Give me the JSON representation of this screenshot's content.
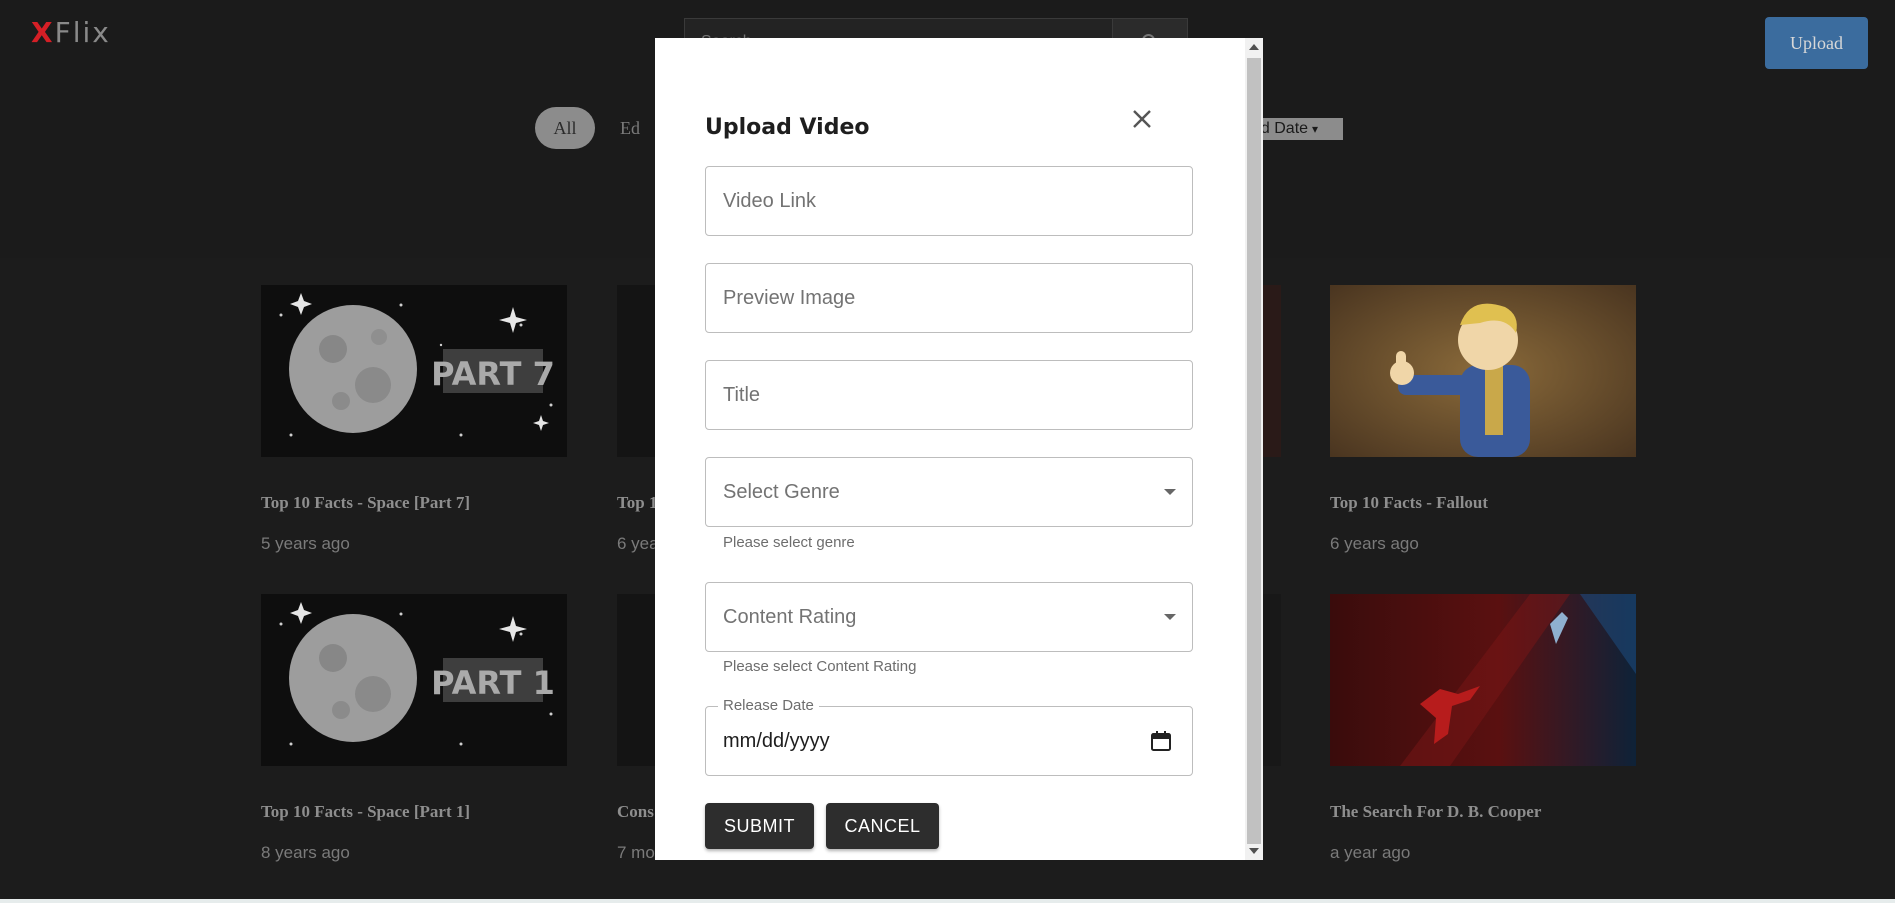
{
  "header": {
    "logo_x": "X",
    "logo_rest": "Flix",
    "search_placeholder": "Search",
    "upload_label": "Upload"
  },
  "filters": {
    "genres": [
      "All",
      "Ed"
    ],
    "sort_label": "ad Date"
  },
  "videos": [
    {
      "title": "Top 10 Facts - Space [Part 7]",
      "age": "5 years ago",
      "thumb_text": "PART 7"
    },
    {
      "title": "Top 1",
      "age": "6 yea"
    },
    {
      "title": "Top 10 Facts - Fallout",
      "age": "6 years ago"
    },
    {
      "title": "Top 10 Facts - Space [Part 1]",
      "age": "8 years ago",
      "thumb_text": "PART 1"
    },
    {
      "title": "Cons",
      "age": "7 mo"
    },
    {
      "title": "The Search For D. B. Cooper",
      "age": "a year ago"
    }
  ],
  "modal": {
    "title": "Upload Video",
    "video_link_placeholder": "Video Link",
    "preview_image_placeholder": "Preview Image",
    "title_placeholder": "Title",
    "genre_placeholder": "Select Genre",
    "genre_helper": "Please select genre",
    "rating_placeholder": "Content Rating",
    "rating_helper": "Please select Content Rating",
    "release_date_label": "Release Date",
    "release_date_value": "mm/dd/yyyy",
    "submit_label": "SUBMIT",
    "cancel_label": "CANCEL"
  },
  "colors": {
    "logo_accent": "#d51f26",
    "upload_button": "#3b6c9e",
    "modal_button": "#2d2d2d"
  }
}
